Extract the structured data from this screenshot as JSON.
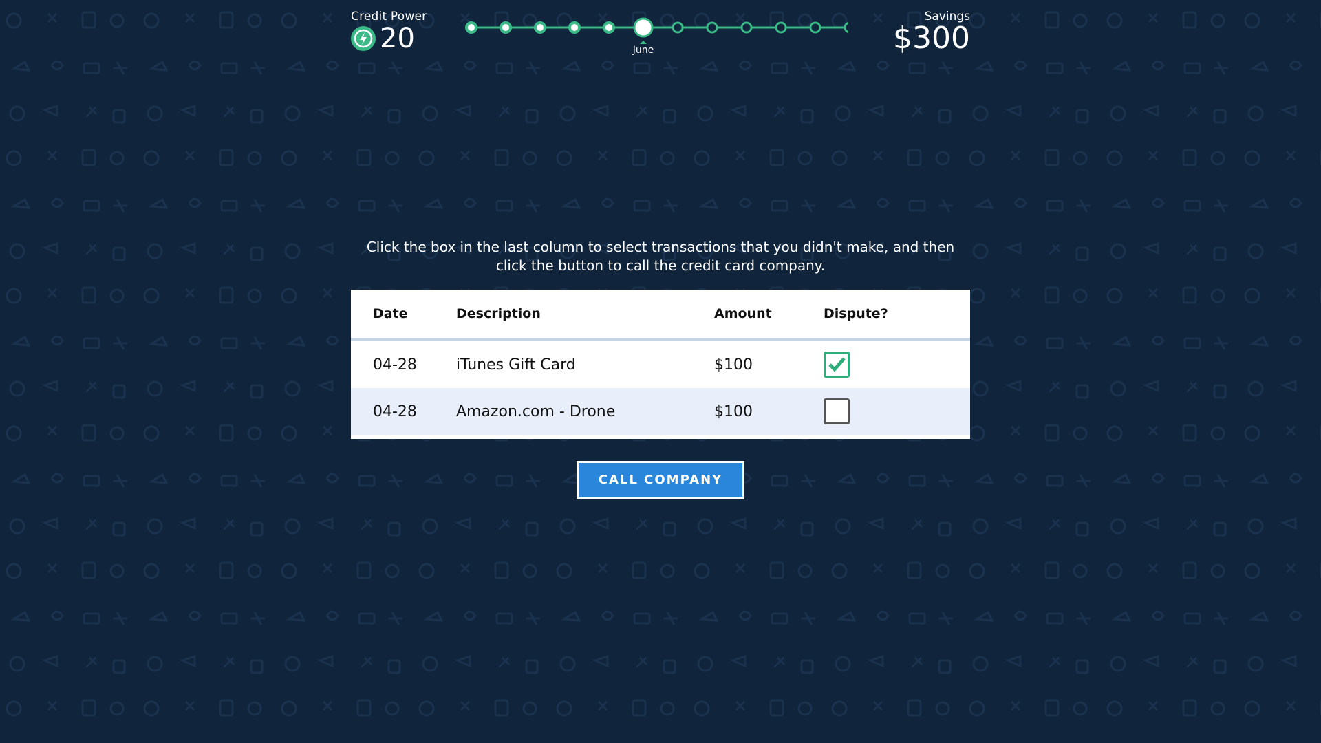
{
  "header": {
    "credit_power_label": "Credit Power",
    "credit_power_value": "20",
    "savings_label": "Savings",
    "savings_value": "$300"
  },
  "timeline": {
    "total_steps": 12,
    "completed_steps": 5,
    "current_step_index": 5,
    "current_label": "June"
  },
  "instructions": "Click the box in the last column to select transactions that you didn't make, and then click the button to call the credit card company.",
  "table": {
    "headers": [
      "Date",
      "Description",
      "Amount",
      "Dispute?"
    ],
    "rows": [
      {
        "date": "04-28",
        "description": "iTunes Gift Card",
        "amount": "$100",
        "dispute": true
      },
      {
        "date": "04-28",
        "description": "Amazon.com - Drone",
        "amount": "$100",
        "dispute": false
      }
    ]
  },
  "button": {
    "label": "CALL COMPANY"
  },
  "colors": {
    "background": "#10243b",
    "accent_green": "#3bb987",
    "button_blue": "#2a86da",
    "row_alt": "#e8effb"
  }
}
